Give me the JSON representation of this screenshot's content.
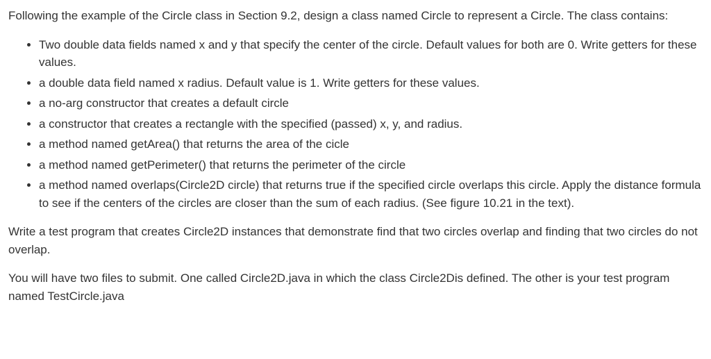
{
  "intro": "Following the example of the Circle class in Section 9.2, design a class named Circle to represent a Circle. The class contains:",
  "bullets": [
    "Two double data fields named x and y that specify the center of the circle. Default values for both are 0. Write getters for these values.",
    "a double data field named x radius. Default value is 1. Write getters for these values.",
    "a no-arg constructor that creates a default circle",
    "a constructor that creates a rectangle with the specified (passed) x, y, and radius.",
    "a method named getArea() that returns the area of the cicle",
    "a method named  getPerimeter() that returns the perimeter of the circle",
    "a method named overlaps(Circle2D circle) that returns true if the specified circle overlaps this circle. Apply the distance formula to see if the centers of the circles are closer than the sum of each radius. (See figure 10.21 in the text)."
  ],
  "para2": "Write a test program that creates Circle2D instances that demonstrate find that two circles overlap and finding that two circles do not overlap.",
  "para3": "You will have two files to submit. One called Circle2D.java in which the class Circle2Dis defined. The other is your test program named TestCircle.java"
}
